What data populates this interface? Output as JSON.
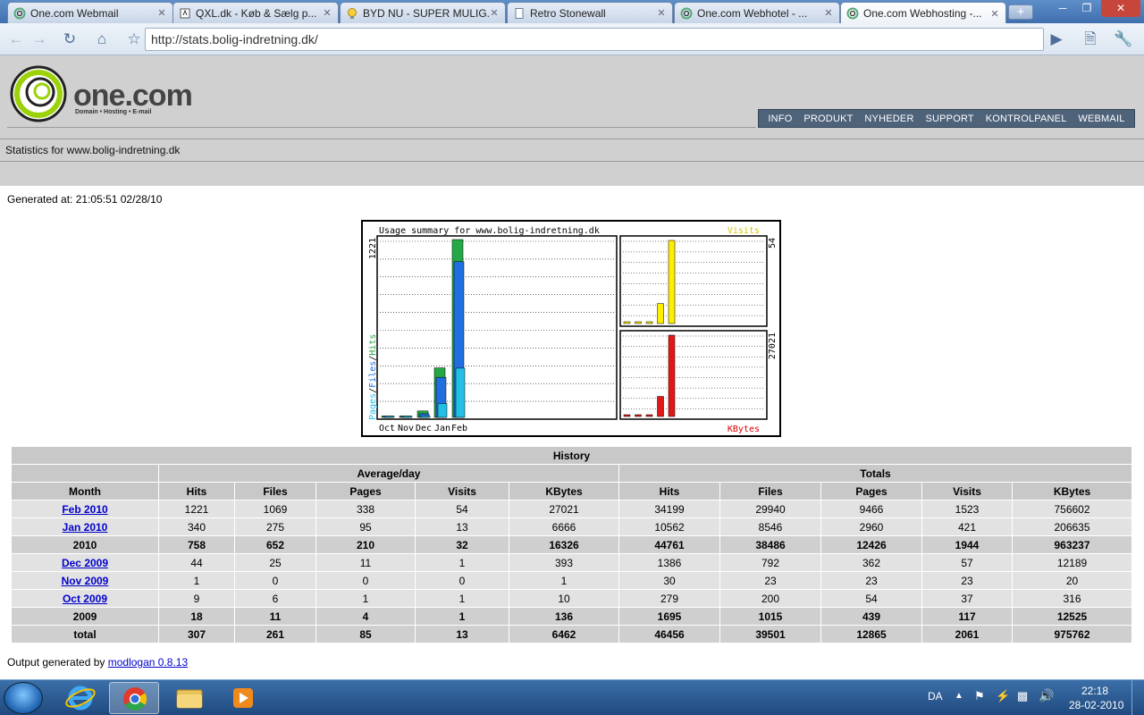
{
  "browser": {
    "tabs": [
      {
        "label": "One.com Webmail",
        "icon": "onecom-icon",
        "active": false
      },
      {
        "label": "QXL.dk - Køb & Sælg p...",
        "icon": "qxl-icon",
        "active": false
      },
      {
        "label": "BYD NU - SUPER MULIG...",
        "icon": "bulb-icon",
        "active": false
      },
      {
        "label": "Retro Stonewall",
        "icon": "page-icon",
        "active": false
      },
      {
        "label": "One.com Webhotel  - ...",
        "icon": "onecom-icon",
        "active": false
      },
      {
        "label": "One.com Webhosting -...",
        "icon": "onecom-icon",
        "active": true
      }
    ],
    "new_tab": "+",
    "url": "http://stats.bolig-indretning.dk/"
  },
  "site": {
    "logo_text": "one.com",
    "logo_tagline": "Domain • Hosting • E-mail",
    "nav": [
      "INFO",
      "PRODUKT",
      "NYHEDER",
      "SUPPORT",
      "KONTROLPANEL",
      "WEBMAIL"
    ],
    "stats_for": "Statistics for www.bolig-indretning.dk",
    "generated": "Generated at: 21:05:51 02/28/10"
  },
  "chart_data": {
    "type": "bar",
    "title": "Usage summary for www.bolig-indretning.dk",
    "categories": [
      "Oct",
      "Nov",
      "Dec",
      "Jan",
      "Feb"
    ],
    "main_panel": {
      "ylabel_parts": [
        "Pages",
        "/",
        "Files",
        "/",
        "Hits"
      ],
      "ymax_label": "1221",
      "ymax": 1221,
      "series": [
        {
          "name": "Hits",
          "color": "#22a844",
          "values": [
            9,
            1,
            44,
            340,
            1221
          ]
        },
        {
          "name": "Files",
          "color": "#1f6fe0",
          "values": [
            6,
            0,
            25,
            275,
            1069
          ]
        },
        {
          "name": "Pages",
          "color": "#22c0e8",
          "values": [
            1,
            0,
            11,
            95,
            338
          ]
        }
      ]
    },
    "visits_panel": {
      "label": "Visits",
      "ymax_label": "54",
      "ymax": 54,
      "color": "#ffee00",
      "values": [
        1,
        0,
        1,
        13,
        54
      ]
    },
    "kbytes_panel": {
      "label": "KBytes",
      "ymax_label": "27021",
      "ymax": 27021,
      "color": "#e01818",
      "values": [
        10,
        1,
        393,
        6666,
        27021
      ]
    }
  },
  "history": {
    "caption": "History",
    "group_avg": "Average/day",
    "group_totals": "Totals",
    "columns": [
      "Month",
      "Hits",
      "Files",
      "Pages",
      "Visits",
      "KBytes",
      "Hits",
      "Files",
      "Pages",
      "Visits",
      "KBytes"
    ],
    "rows": [
      {
        "month": "Feb 2010",
        "link": true,
        "cells": [
          "1221",
          "1069",
          "338",
          "54",
          "27021",
          "34199",
          "29940",
          "9466",
          "1523",
          "756602"
        ]
      },
      {
        "month": "Jan 2010",
        "link": true,
        "cells": [
          "340",
          "275",
          "95",
          "13",
          "6666",
          "10562",
          "8546",
          "2960",
          "421",
          "206635"
        ]
      },
      {
        "month": "2010",
        "link": false,
        "cells": [
          "758",
          "652",
          "210",
          "32",
          "16326",
          "44761",
          "38486",
          "12426",
          "1944",
          "963237"
        ]
      },
      {
        "month": "Dec 2009",
        "link": true,
        "cells": [
          "44",
          "25",
          "11",
          "1",
          "393",
          "1386",
          "792",
          "362",
          "57",
          "12189"
        ]
      },
      {
        "month": "Nov 2009",
        "link": true,
        "cells": [
          "1",
          "0",
          "0",
          "0",
          "1",
          "30",
          "23",
          "23",
          "23",
          "20"
        ]
      },
      {
        "month": "Oct 2009",
        "link": true,
        "cells": [
          "9",
          "6",
          "1",
          "1",
          "10",
          "279",
          "200",
          "54",
          "37",
          "316"
        ]
      },
      {
        "month": "2009",
        "link": false,
        "cells": [
          "18",
          "11",
          "4",
          "1",
          "136",
          "1695",
          "1015",
          "439",
          "117",
          "12525"
        ]
      },
      {
        "month": "total",
        "link": false,
        "cells": [
          "307",
          "261",
          "85",
          "13",
          "6462",
          "46456",
          "39501",
          "12865",
          "2061",
          "975762"
        ]
      }
    ]
  },
  "footer": {
    "prefix": "Output generated by ",
    "link": "modlogan 0.8.13"
  },
  "taskbar": {
    "language": "DA",
    "time": "22:18",
    "date": "28-02-2010"
  }
}
